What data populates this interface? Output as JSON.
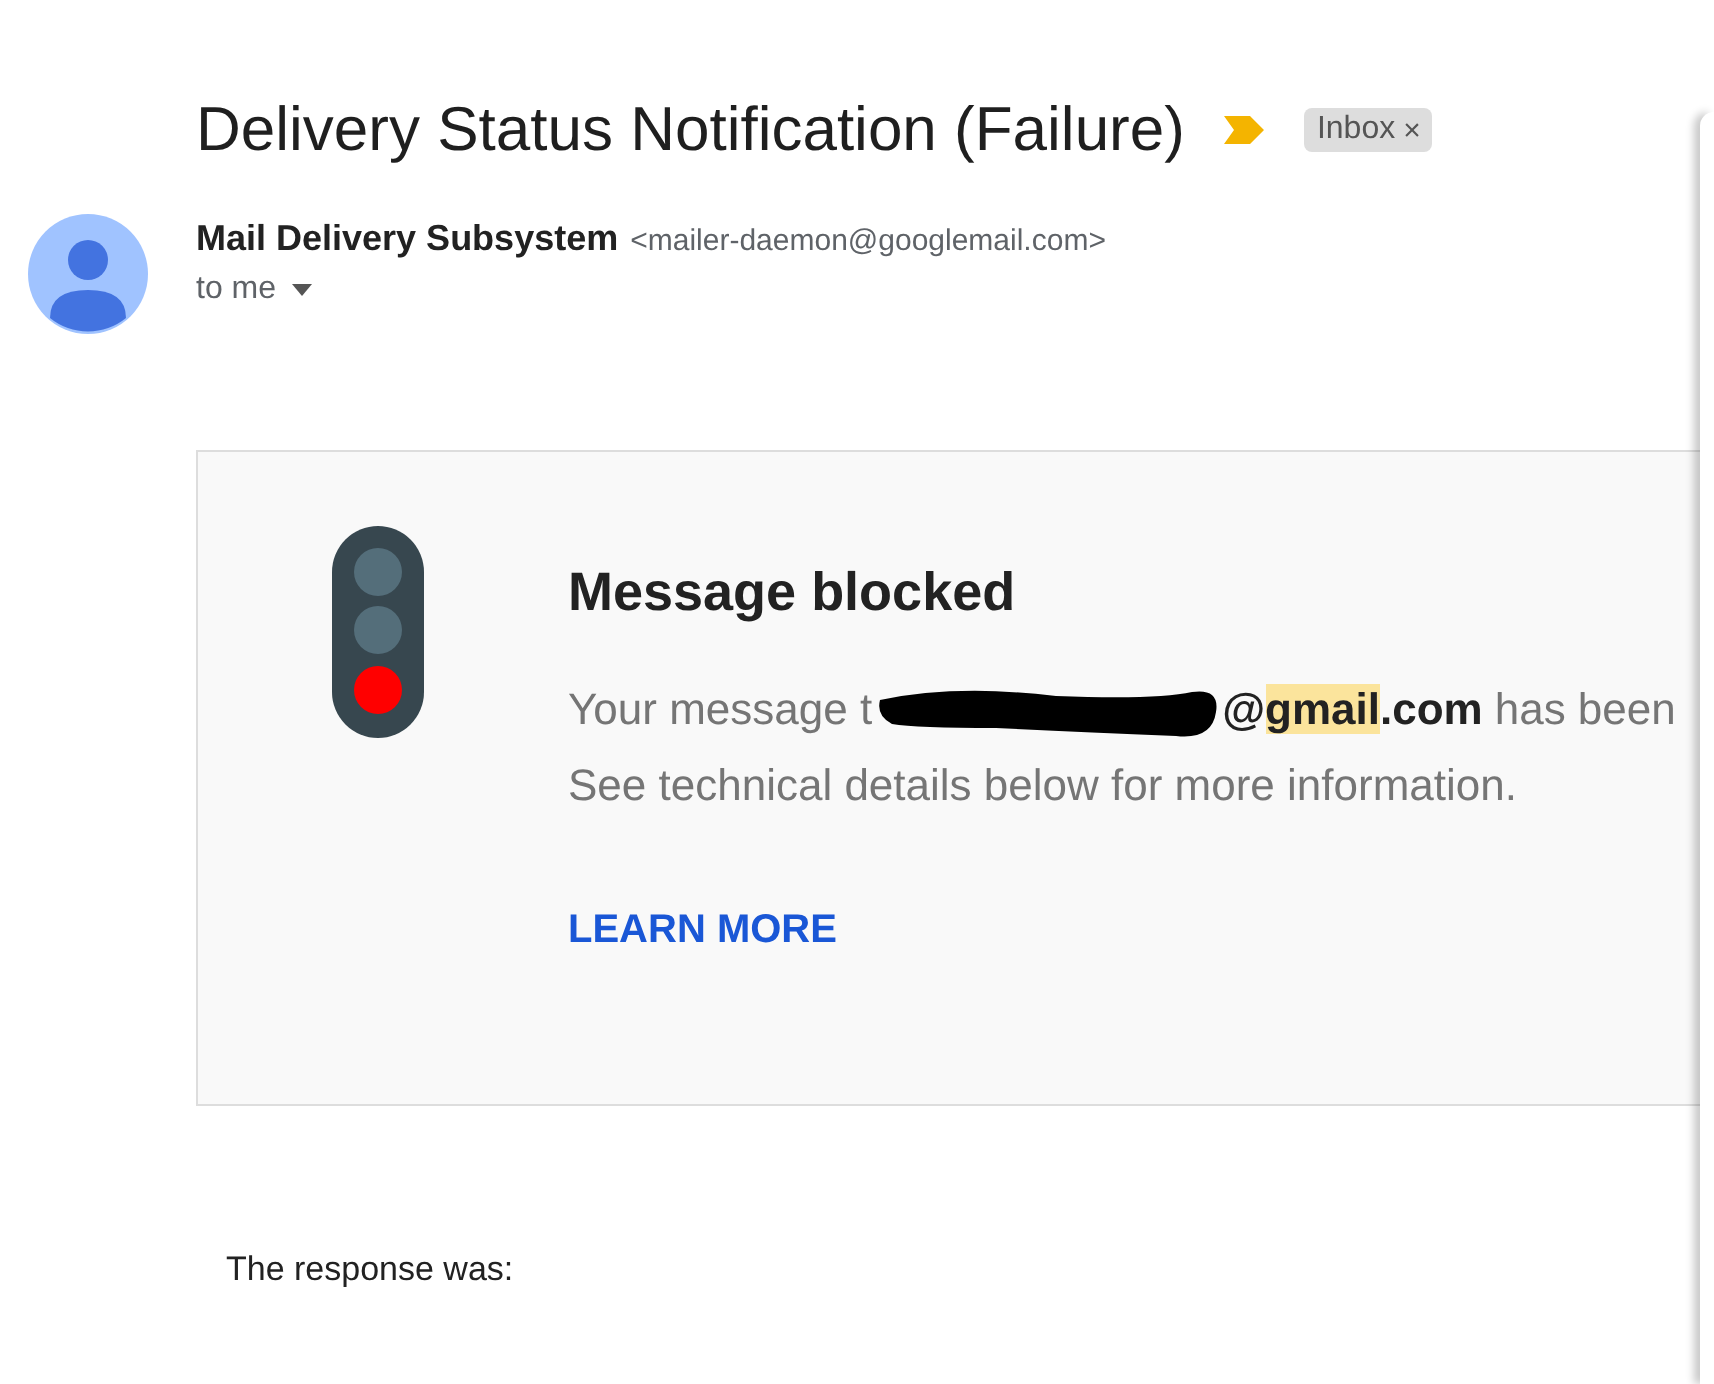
{
  "subject": "Delivery Status Notification (Failure)",
  "important": true,
  "label": {
    "text": "Inbox",
    "close": "×"
  },
  "sender": {
    "name": "Mail Delivery Subsystem",
    "address": "<mailer-daemon@googlemail.com>",
    "recipient": "to me"
  },
  "card": {
    "title": "Message blocked",
    "message_before": "Your message t",
    "redacted": true,
    "email_parts": {
      "before": "@",
      "match": "gmail",
      "after": ".com"
    },
    "message_after": "has been",
    "message_line2": "See technical details below for more information.",
    "link": "LEARN MORE"
  },
  "response_label": "The response was:"
}
